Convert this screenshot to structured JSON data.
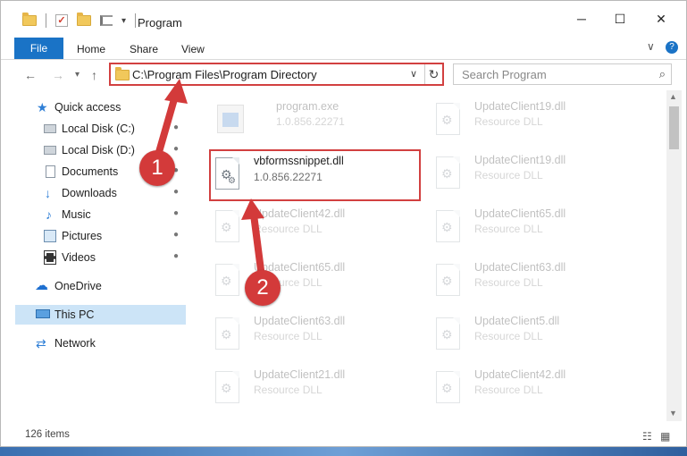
{
  "window": {
    "title": "Program",
    "controls": {
      "minimize": "─",
      "maximize": "☐",
      "close": "✕"
    }
  },
  "ribbon": {
    "tabs": [
      "File",
      "Home",
      "Share",
      "View"
    ],
    "collapse_icon": "chevron-down-icon",
    "help_icon": "help-icon",
    "help_glyph": "?"
  },
  "nav": {
    "back": "←",
    "forward": "→",
    "recent": "▾",
    "up": "↑",
    "address": "C:\\Program Files\\Program Directory",
    "address_dropdown": "∨",
    "refresh": "↻",
    "search_placeholder": "Search Program",
    "search_icon": "⌕"
  },
  "sidebar": {
    "items": [
      {
        "label": "Quick access",
        "icon": "star-icon",
        "glyph": "★",
        "pinned": false
      },
      {
        "label": "Local Disk (C:)",
        "icon": "disk-icon",
        "glyph": "",
        "pinned": true
      },
      {
        "label": "Local Disk (D:)",
        "icon": "disk-icon",
        "glyph": "",
        "pinned": true
      },
      {
        "label": "Documents",
        "icon": "documents-icon",
        "glyph": "",
        "pinned": true
      },
      {
        "label": "Downloads",
        "icon": "download-icon",
        "glyph": "↓",
        "pinned": true
      },
      {
        "label": "Music",
        "icon": "music-icon",
        "glyph": "♪",
        "pinned": true
      },
      {
        "label": "Pictures",
        "icon": "pictures-icon",
        "glyph": "",
        "pinned": true
      },
      {
        "label": "Videos",
        "icon": "videos-icon",
        "glyph": "",
        "pinned": true
      },
      {
        "label": "OneDrive",
        "icon": "cloud-icon",
        "glyph": "☁",
        "pinned": false
      },
      {
        "label": "This PC",
        "icon": "computer-icon",
        "glyph": "",
        "pinned": false,
        "selected": true
      },
      {
        "label": "Network",
        "icon": "network-icon",
        "glyph": "⇄",
        "pinned": false
      }
    ],
    "pin_glyph": "📌"
  },
  "files": {
    "left": [
      {
        "name": "program.exe",
        "sub": "1.0.856.22271",
        "type": "exe",
        "faded": true
      },
      {
        "name": "vbformssnippet.dll",
        "sub": "1.0.856.22271",
        "type": "dll",
        "faded": false,
        "highlighted": true
      },
      {
        "name": "UpdateClient42.dll",
        "sub": "Resource DLL",
        "type": "dll",
        "faded": true
      },
      {
        "name": "UpdateClient65.dll",
        "sub": "Resource DLL",
        "type": "dll",
        "faded": true
      },
      {
        "name": "UpdateClient63.dll",
        "sub": "Resource DLL",
        "type": "dll",
        "faded": true
      },
      {
        "name": "UpdateClient21.dll",
        "sub": "Resource DLL",
        "type": "dll",
        "faded": true
      }
    ],
    "right": [
      {
        "name": "UpdateClient19.dll",
        "sub": "Resource DLL",
        "type": "dll",
        "faded": true
      },
      {
        "name": "UpdateClient19.dll",
        "sub": "Resource DLL",
        "type": "dll",
        "faded": true
      },
      {
        "name": "UpdateClient65.dll",
        "sub": "Resource DLL",
        "type": "dll",
        "faded": true
      },
      {
        "name": "UpdateClient63.dll",
        "sub": "Resource DLL",
        "type": "dll",
        "faded": true
      },
      {
        "name": "UpdateClient5.dll",
        "sub": "Resource DLL",
        "type": "dll",
        "faded": true
      },
      {
        "name": "UpdateClient42.dll",
        "sub": "Resource DLL",
        "type": "dll",
        "faded": true
      }
    ]
  },
  "status": {
    "count": "126 items",
    "details_view": "☷",
    "tiles_view": "▦"
  },
  "annotations": {
    "badge1": "1",
    "badge2": "2",
    "color": "#d33a3a"
  },
  "colors": {
    "accent": "#1a73c6",
    "selection": "#cce4f7",
    "highlight_border": "#d24040"
  }
}
